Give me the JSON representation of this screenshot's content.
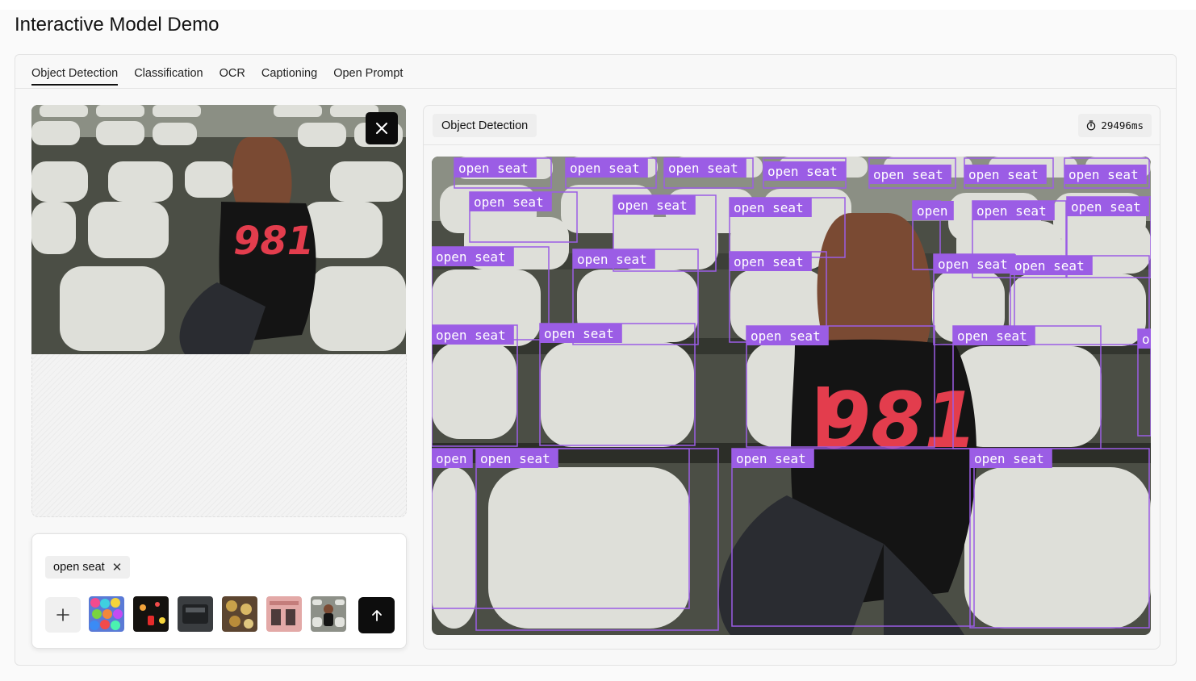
{
  "page_title": "Interactive Model Demo",
  "tabs": [
    {
      "label": "Object Detection",
      "active": true
    },
    {
      "label": "Classification",
      "active": false
    },
    {
      "label": "OCR",
      "active": false
    },
    {
      "label": "Captioning",
      "active": false
    },
    {
      "label": "Open Prompt",
      "active": false
    }
  ],
  "input": {
    "image_icon": "seats-photo",
    "close_icon": "close-icon",
    "prompt_tags": [
      {
        "label": "open seat",
        "remove_icon": "close-icon"
      }
    ],
    "add_icon": "plus-icon",
    "sample_thumbnails": [
      "colorful-balls",
      "neon-arcade",
      "dark-gadget",
      "coins",
      "pink-storefront",
      "woman-on-seats"
    ],
    "send_icon": "arrow-up-icon"
  },
  "result": {
    "title": "Object Detection",
    "timer_icon": "stopwatch-icon",
    "elapsed": "29496ms",
    "detection_color": "#9b5de5",
    "detections": [
      "open seat",
      "open seat",
      "open seat",
      "open seat",
      "open seat",
      "open seat",
      "open seat",
      "open seat",
      "open seat",
      "open seat",
      "open",
      "open seat",
      "open seat",
      "open seat",
      "open seat",
      "open seat",
      "open seat",
      "open seat",
      "open seat",
      "open seat",
      "open seat",
      "open seat",
      "o",
      "open",
      "open seat",
      "open seat",
      "open seat"
    ]
  }
}
